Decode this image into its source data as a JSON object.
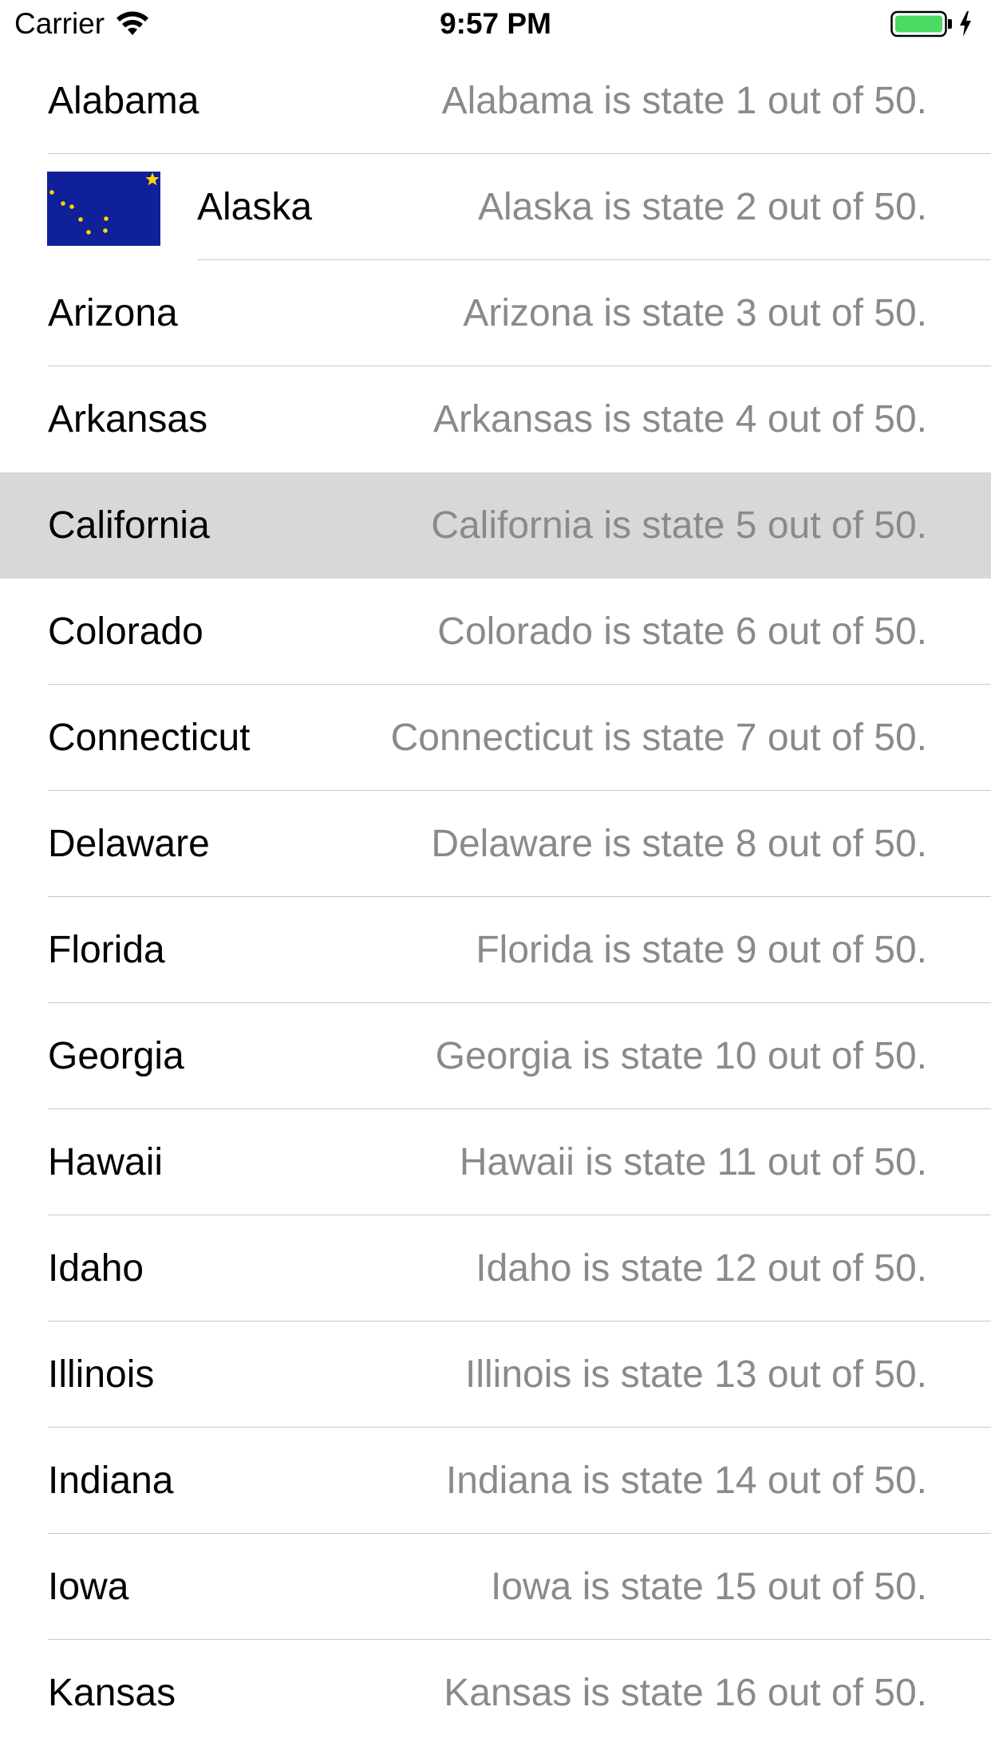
{
  "status_bar": {
    "carrier": "Carrier",
    "time": "9:57 PM",
    "battery_color": "#4cd964"
  },
  "table": {
    "selected_index": 4,
    "rows": [
      {
        "title": "Alabama",
        "detail": "Alabama is state 1 out of 50."
      },
      {
        "title": "Alaska",
        "detail": "Alaska is state 2 out of 50.",
        "image": "alaska-flag"
      },
      {
        "title": "Arizona",
        "detail": "Arizona is state 3 out of 50."
      },
      {
        "title": "Arkansas",
        "detail": "Arkansas is state 4 out of 50."
      },
      {
        "title": "California",
        "detail": "California is state 5 out of 50."
      },
      {
        "title": "Colorado",
        "detail": "Colorado is state 6 out of 50."
      },
      {
        "title": "Connecticut",
        "detail": "Connecticut is state 7 out of 50."
      },
      {
        "title": "Delaware",
        "detail": "Delaware is state 8 out of 50."
      },
      {
        "title": "Florida",
        "detail": "Florida is state 9 out of 50."
      },
      {
        "title": "Georgia",
        "detail": "Georgia is state 10 out of 50."
      },
      {
        "title": "Hawaii",
        "detail": "Hawaii is state 11 out of 50."
      },
      {
        "title": "Idaho",
        "detail": "Idaho is state 12 out of 50."
      },
      {
        "title": "Illinois",
        "detail": "Illinois is state 13 out of 50."
      },
      {
        "title": "Indiana",
        "detail": "Indiana is state 14 out of 50."
      },
      {
        "title": "Iowa",
        "detail": "Iowa is state 15 out of 50."
      },
      {
        "title": "Kansas",
        "detail": "Kansas is state 16 out of 50."
      }
    ]
  },
  "colors": {
    "selected_background": "#d8d8d8",
    "detail_text": "#8a8a8e",
    "separator": "#c8c7cc",
    "flag_blue": "#0f2099",
    "flag_gold": "#ffd700"
  }
}
